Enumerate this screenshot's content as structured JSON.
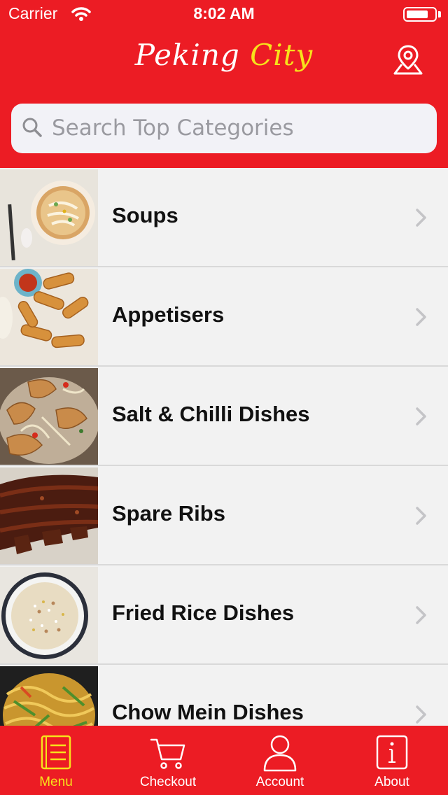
{
  "status_bar": {
    "carrier": "Carrier",
    "time": "8:02 AM"
  },
  "header": {
    "logo_part1": "Peking ",
    "logo_part2": "City"
  },
  "search": {
    "placeholder": "Search Top Categories",
    "value": ""
  },
  "categories": [
    {
      "label": "Soups",
      "icon": "soup-bowl-image"
    },
    {
      "label": "Appetisers",
      "icon": "spring-rolls-image"
    },
    {
      "label": "Salt & Chilli Dishes",
      "icon": "salt-chilli-image"
    },
    {
      "label": "Spare Ribs",
      "icon": "spare-ribs-image"
    },
    {
      "label": "Fried Rice Dishes",
      "icon": "fried-rice-image"
    },
    {
      "label": "Chow Mein Dishes",
      "icon": "chow-mein-image"
    }
  ],
  "tabs": [
    {
      "label": "Menu",
      "icon": "menu-icon",
      "active": true
    },
    {
      "label": "Checkout",
      "icon": "cart-icon",
      "active": false
    },
    {
      "label": "Account",
      "icon": "user-icon",
      "active": false
    },
    {
      "label": "About",
      "icon": "info-icon",
      "active": false
    }
  ],
  "colors": {
    "brand_red": "#ec1c24",
    "accent_yellow": "#f7e21b",
    "list_bg": "#f2f2f2"
  }
}
